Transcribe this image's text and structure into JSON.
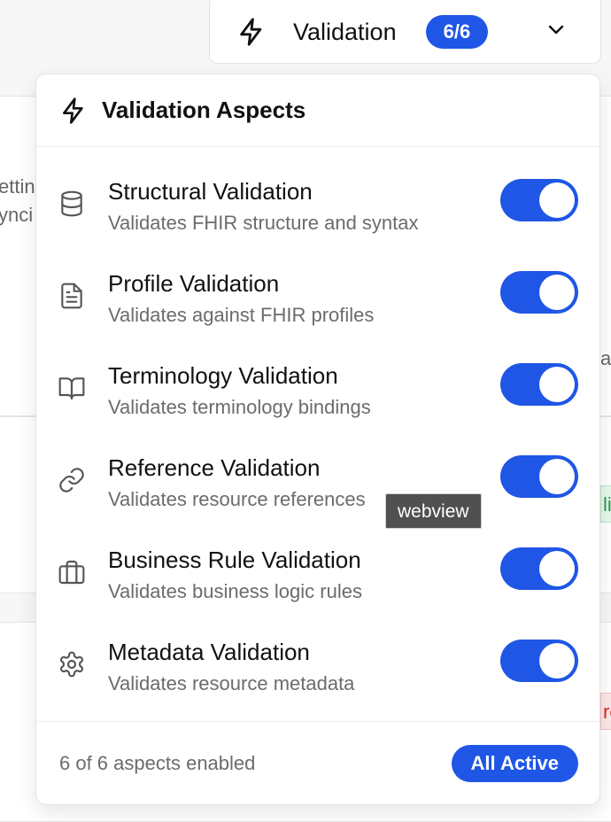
{
  "trigger": {
    "label": "Validation",
    "count": "6/6",
    "bolt_icon": "bolt-icon",
    "chevron_icon": "chevron-down-icon"
  },
  "background": {
    "frag1": "ettin",
    "frag2": "ynci",
    "frag3": "a",
    "frag4": "li",
    "frag5": "ro"
  },
  "panel": {
    "title": "Validation Aspects",
    "aspects": [
      {
        "name": "Structural Validation",
        "description": "Validates FHIR structure and syntax",
        "icon": "database-icon",
        "enabled": true
      },
      {
        "name": "Profile Validation",
        "description": "Validates against FHIR profiles",
        "icon": "file-text-icon",
        "enabled": true
      },
      {
        "name": "Terminology Validation",
        "description": "Validates terminology bindings",
        "icon": "book-open-icon",
        "enabled": true
      },
      {
        "name": "Reference Validation",
        "description": "Validates resource references",
        "icon": "link-icon",
        "enabled": true
      },
      {
        "name": "Business Rule Validation",
        "description": "Validates business logic rules",
        "icon": "briefcase-icon",
        "enabled": true
      },
      {
        "name": "Metadata Validation",
        "description": "Validates resource metadata",
        "icon": "settings-icon",
        "enabled": true
      }
    ],
    "summary": "6 of 6 aspects enabled",
    "all_active_label": "All Active"
  },
  "tooltip": {
    "text": "webview"
  },
  "colors": {
    "accent": "#1f56e6",
    "muted_text": "#6b6b70"
  }
}
